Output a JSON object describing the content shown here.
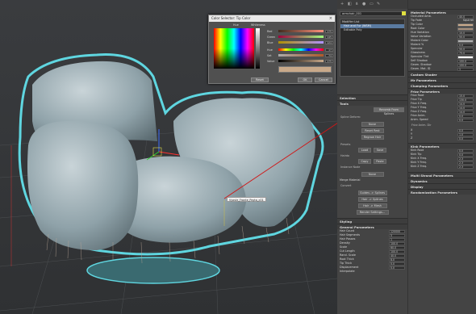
{
  "viewport": {
    "tooltip_label": "Vyovle_Fronte_Poyta_c01"
  },
  "color_dialog": {
    "title": "Color Selector: Tip Color",
    "hue_label": "Hue",
    "whiteness_label": "Whiteness",
    "channels": [
      {
        "name": "Red",
        "value": "175"
      },
      {
        "name": "Green",
        "value": "145"
      },
      {
        "name": "Blue",
        "value": "124"
      },
      {
        "name": "Hue",
        "value": "17"
      },
      {
        "name": "Sat",
        "value": "74"
      },
      {
        "name": "Value",
        "value": "175"
      }
    ],
    "reset_label": "Reset",
    "ok_label": "OK",
    "cancel_label": "Cancel",
    "swatch_color": "#c9a98a"
  },
  "command_panel": {
    "object_name": "armchair_001",
    "modifier_list_label": "Modifier List",
    "modifiers": [
      "Hair and Fur (WSM)",
      "Editable Poly"
    ],
    "rollouts": {
      "selection": "Selection",
      "tools": "Tools",
      "styling": "Styling",
      "general": "General Parameters"
    },
    "tools": {
      "recomb_button": "Recomb From Splines",
      "spline_deform_label": "Spline Deform:",
      "none_label": "None",
      "reset_rest": "Reset Rest",
      "regrow_hair": "Regrow Hair",
      "presets_label": "Presets",
      "load": "Load",
      "save": "Save",
      "hairdo_label": "Hairdo",
      "copy": "Copy",
      "paste": "Paste",
      "instance_node_label": "Instance Node",
      "merge_material": "Merge Material",
      "convert_label": "Convert",
      "guides_to_splines": "Guides -> Splines",
      "hair_to_splines": "Hair -> Splines",
      "hair_to_mesh": "Hair -> Mesh",
      "render_settings": "Render Settings..."
    },
    "general": [
      {
        "label": "Hair Count",
        "value": "120000"
      },
      {
        "label": "Hair Segments",
        "value": "5"
      },
      {
        "label": "Hair Passes",
        "value": "1"
      },
      {
        "label": "Density",
        "value": "100.0"
      },
      {
        "label": "Scale",
        "value": "60.0"
      },
      {
        "label": "Cut Length",
        "value": "100.0"
      },
      {
        "label": "Rand. Scale",
        "value": "40.0"
      },
      {
        "label": "Root Thick",
        "value": "8.0"
      },
      {
        "label": "Tip Thick",
        "value": "0.0"
      },
      {
        "label": "Displacement",
        "value": "0.0"
      }
    ],
    "interpolate_label": "Interpolate"
  },
  "material_panel": {
    "rollout": "Material Parameters",
    "rows": [
      {
        "label": "Occluded Amb.",
        "value": "40.0"
      },
      {
        "label": "Tip Fade",
        "value": ""
      },
      {
        "label": "Tip Color",
        "value": ""
      },
      {
        "label": "Root Color",
        "value": ""
      },
      {
        "label": "Hue Variation",
        "value": "10.0"
      },
      {
        "label": "Value Variation",
        "value": "50.0"
      },
      {
        "label": "Mutant Color",
        "value": ""
      },
      {
        "label": "Mutant %",
        "value": "0.0"
      },
      {
        "label": "Specular",
        "value": "50.0"
      },
      {
        "label": "Glossiness",
        "value": "75.0"
      },
      {
        "label": "Specular Tint",
        "value": ""
      },
      {
        "label": "Self Shadow",
        "value": "100.0"
      },
      {
        "label": "Geom. Shadow",
        "value": "100.0"
      },
      {
        "label": "Geom. Mat. ID",
        "value": "1"
      }
    ],
    "squirrel_label": "Squirrel",
    "specular_label": "Specular",
    "secondary_label": "Secondary",
    "rollouts_mid": [
      "Custom Shader",
      "Mr Parameters",
      "Clumping Parameters",
      "Frizz Parameters"
    ],
    "frizz": [
      {
        "label": "Frizz Root",
        "value": "15.0"
      },
      {
        "label": "Frizz Tip",
        "value": "130.0"
      },
      {
        "label": "Frizz X Freq.",
        "value": "14.0"
      },
      {
        "label": "Frizz Y Freq.",
        "value": "14.0"
      },
      {
        "label": "Frizz Z Freq.",
        "value": "14.0"
      },
      {
        "label": "Frizz Anim.",
        "value": "0.0"
      },
      {
        "label": "Anim. Speed",
        "value": "0.0"
      }
    ],
    "frizz_anim_dir": "Frizz Anim. Dir",
    "frizz_xyz": [
      {
        "label": "X",
        "value": "0.0"
      },
      {
        "label": "Y",
        "value": "1.0"
      },
      {
        "label": "Z",
        "value": "0.0"
      }
    ],
    "kink_rollout": "Kink Parameters",
    "kink": [
      {
        "label": "Kink Root",
        "value": "0.0"
      },
      {
        "label": "Kink Tip",
        "value": "0.0"
      },
      {
        "label": "Kink X Freq.",
        "value": "2.3"
      },
      {
        "label": "Kink Y Freq.",
        "value": "2.3"
      },
      {
        "label": "Kink Z Freq.",
        "value": "2.3"
      }
    ],
    "rollouts_bottom": [
      "Multi Strand Parameters",
      "Dynamics",
      "Display",
      "Randomization Parameters"
    ]
  },
  "colors": {
    "fur_accent": "#5fd6e0",
    "selection_blue": "#5a7aa0",
    "tip_swatch": "#c9a98a",
    "root_swatch": "#a48c78"
  }
}
